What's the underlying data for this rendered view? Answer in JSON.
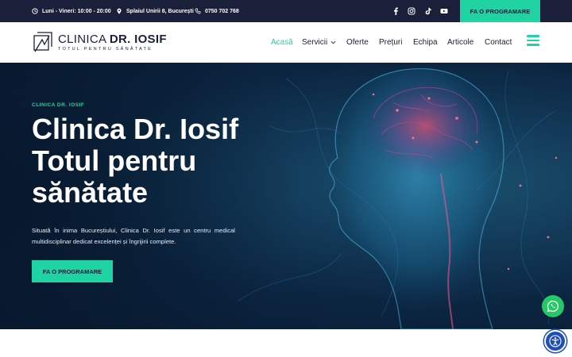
{
  "topbar": {
    "hours": "Luni - Vineri: 10:00 - 20:00",
    "address": "Splaiul Unirii 8, București",
    "phone": "0750 702 768",
    "social_icons": [
      "facebook-icon",
      "instagram-icon",
      "tiktok-icon",
      "youtube-icon"
    ],
    "cta_label": "FA O PROGRAMARE"
  },
  "header": {
    "logo_name_light": "CLINICA ",
    "logo_name_bold": "DR. IOSIF",
    "logo_tagline": "TOTUL PENTRU SĂNĂTATE",
    "nav": [
      {
        "label": "Acasă",
        "active": true
      },
      {
        "label": "Servicii",
        "dropdown": true
      },
      {
        "label": "Oferte"
      },
      {
        "label": "Prețuri"
      },
      {
        "label": "Echipa"
      },
      {
        "label": "Articole"
      },
      {
        "label": "Contact"
      }
    ]
  },
  "hero": {
    "eyebrow": "CLINICA DR. IOSIF",
    "title_lines": [
      "Clinica Dr. Iosif",
      "Totul pentru",
      "sănătate"
    ],
    "description": "Situată în inima Bucureștiului, Clinica Dr. Iosif este un centru medical multidisciplinar dedicat excelenței și îngrijirii complete.",
    "cta_label": "FA O PROGRAMARE"
  },
  "floating": {
    "whatsapp_icon": "whatsapp-icon",
    "accessibility_icon": "accessibility-icon"
  },
  "colors": {
    "accent": "#1fd3a2",
    "navy": "#1a1f3a",
    "hero_bg": "#0b2440",
    "whatsapp": "#25c866",
    "accessibility": "#1e4fb8"
  }
}
